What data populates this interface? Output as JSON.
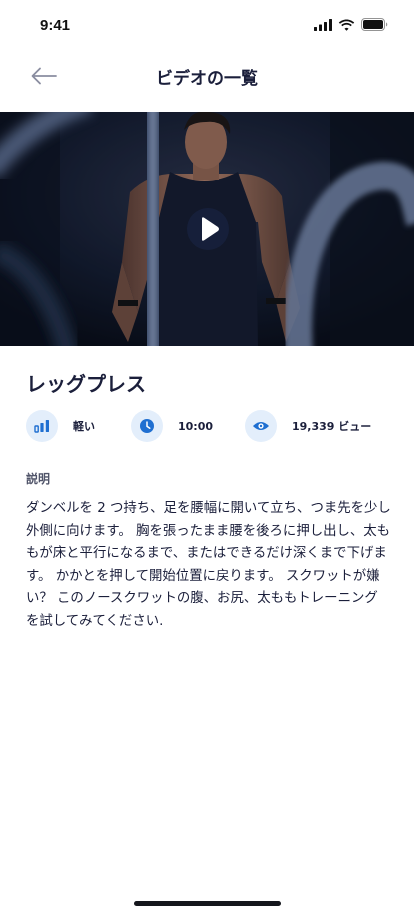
{
  "status_bar": {
    "time": "9:41",
    "icons": [
      "signal-icon",
      "wifi-icon",
      "battery-icon"
    ]
  },
  "header": {
    "title": "ビデオの一覧",
    "back_icon": "arrow-left-icon"
  },
  "video": {
    "play_icon": "play-icon",
    "title": "レッグプレス"
  },
  "stats": {
    "difficulty": {
      "icon": "bar-chart-icon",
      "label": "軽い"
    },
    "duration": {
      "icon": "clock-icon",
      "label": "10:00"
    },
    "views": {
      "icon": "eye-icon",
      "label": "19,339 ビュー"
    }
  },
  "description": {
    "heading": "説明",
    "body": "ダンベルを 2 つ持ち、足を腰幅に開いて立ち、つま先を少し外側に向けます。 胸を張ったまま腰を後ろに押し出し、太ももが床と平行になるまで、またはできるだけ深くまで下げます。 かかとを押して開始位置に戻ります。 スクワットが嫌い？ このノースクワットの腹、お尻、太ももトレーニングを試してみてください."
  },
  "colors": {
    "primary_text": "#1b1f3b",
    "accent": "#1f6fd1",
    "icon_bg": "#e3eefb"
  }
}
